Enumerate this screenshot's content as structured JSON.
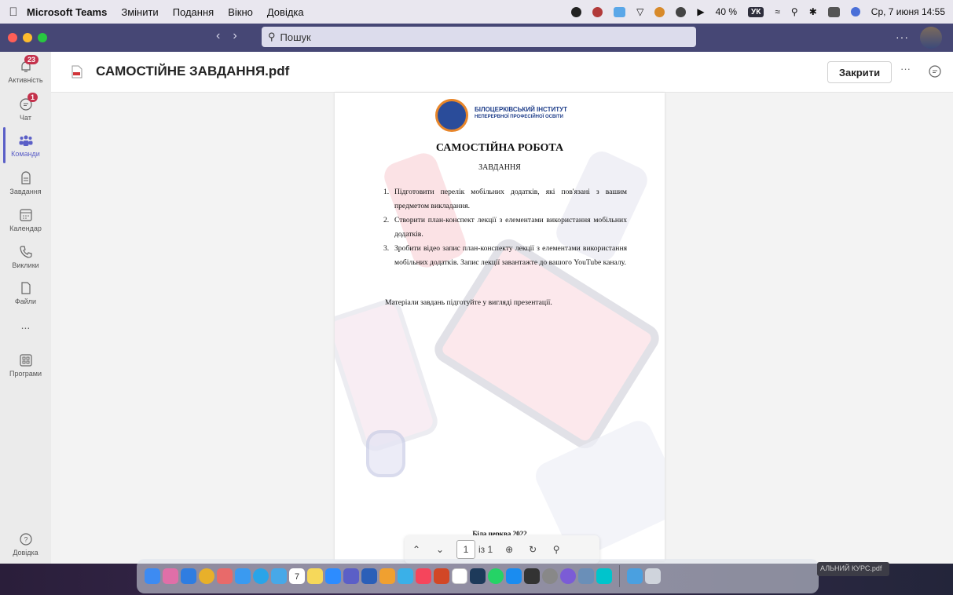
{
  "menubar": {
    "app": "Microsoft Teams",
    "items": [
      "Змінити",
      "Подання",
      "Вікно",
      "Довідка"
    ],
    "battery": "40 %",
    "keyboard": "УК",
    "datetime": "Ср, 7 июня 14:55"
  },
  "titlebar": {
    "search_placeholder": "Пошук"
  },
  "rail": {
    "items": [
      {
        "label": "Активність",
        "icon": "bell-icon",
        "badge": "23"
      },
      {
        "label": "Чат",
        "icon": "chat-icon",
        "badge": "1"
      },
      {
        "label": "Команди",
        "icon": "teams-icon",
        "badge": ""
      },
      {
        "label": "Завдання",
        "icon": "assignments-icon",
        "badge": ""
      },
      {
        "label": "Календар",
        "icon": "calendar-icon",
        "badge": ""
      },
      {
        "label": "Виклики",
        "icon": "phone-icon",
        "badge": ""
      },
      {
        "label": "Файли",
        "icon": "file-icon",
        "badge": ""
      },
      {
        "label": "...",
        "icon": "more-icon",
        "badge": ""
      },
      {
        "label": "Програми",
        "icon": "apps-icon",
        "badge": ""
      }
    ],
    "help": "Довідка",
    "active_index": 2
  },
  "header": {
    "title": "САМОСТІЙНЕ ЗАВДАННЯ.pdf",
    "close_label": "Закрити",
    "more": "···"
  },
  "document": {
    "institute_name": "БІЛОЦЕРКІВСЬКИЙ ІНСТИТУТ",
    "institute_sub": "НЕПЕРЕРВНОЇ ПРОФЕСІЙНОЇ ОСВІТИ",
    "heading": "САМОСТІЙНА РОБОТА",
    "subheading": "ЗАВДАННЯ",
    "tasks": [
      {
        "num": "1.",
        "text": "Підготовити перелік мобільних додатків, які пов'язані з вашим предметом викладання."
      },
      {
        "num": "2.",
        "text": "Створити план-конспект лекції з елементами використання мобільних додатків."
      },
      {
        "num": "3.",
        "text": "Зробити відео запис план-конспекту лекції з елементами використання мобільних додатків. Запис лекції завантажте до вашого YouTube каналу."
      }
    ],
    "note": "Матеріали завдань підготуйте у вигляді презентації.",
    "footer": "Біла церква 2022"
  },
  "pdf_toolbar": {
    "page": "1",
    "of": "із 1"
  },
  "dock": {
    "file_label": "АЛЬНИЙ КУРС.pdf",
    "calendar_day": "7"
  },
  "colors": {
    "teams_purple": "#464775",
    "accent": "#5b5fc7",
    "badge_red": "#c4314b"
  }
}
